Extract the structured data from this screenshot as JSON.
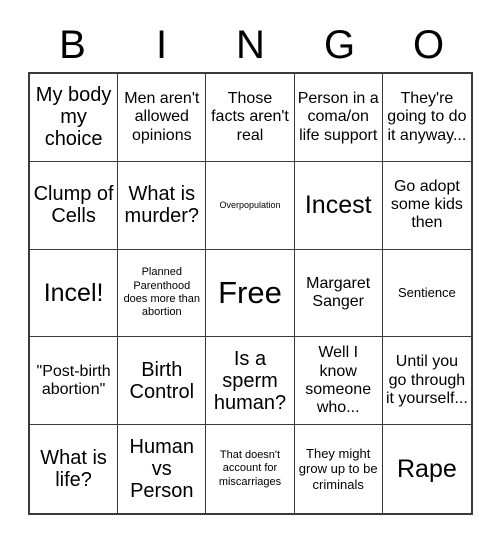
{
  "header": {
    "letters": [
      "B",
      "I",
      "N",
      "G",
      "O"
    ]
  },
  "grid": {
    "rows": 5,
    "columns": 5,
    "free_space_index": 12,
    "cells": [
      {
        "text": "My body my choice",
        "size": "lg"
      },
      {
        "text": "Men aren't allowed opinions",
        "size": "md"
      },
      {
        "text": "Those facts aren't real",
        "size": "md"
      },
      {
        "text": "Person in a coma/on life support",
        "size": "md"
      },
      {
        "text": "They're going to do it anyway...",
        "size": "md"
      },
      {
        "text": "Clump of Cells",
        "size": "lg"
      },
      {
        "text": "What is murder?",
        "size": "lg"
      },
      {
        "text": "Overpopulation",
        "size": "xxs"
      },
      {
        "text": "Incest",
        "size": "xl"
      },
      {
        "text": "Go adopt some kids then",
        "size": "md"
      },
      {
        "text": "Incel!",
        "size": "xl"
      },
      {
        "text": "Planned Parenthood does more than abortion",
        "size": "xs"
      },
      {
        "text": "Free",
        "size": "xxl"
      },
      {
        "text": "Margaret Sanger",
        "size": "md"
      },
      {
        "text": "Sentience",
        "size": "sm"
      },
      {
        "text": "\"Post-birth abortion\"",
        "size": "md"
      },
      {
        "text": "Birth Control",
        "size": "lg"
      },
      {
        "text": "Is a sperm human?",
        "size": "lg"
      },
      {
        "text": "Well I know someone who...",
        "size": "md"
      },
      {
        "text": "Until you go through it yourself...",
        "size": "md"
      },
      {
        "text": "What is life?",
        "size": "lg"
      },
      {
        "text": "Human vs Person",
        "size": "lg"
      },
      {
        "text": "That doesn't account for miscarriages",
        "size": "xs"
      },
      {
        "text": "They might grow up to be criminals",
        "size": "sm"
      },
      {
        "text": "Rape",
        "size": "xl"
      }
    ]
  },
  "colors": {
    "background": "#ffffff",
    "text": "#000000",
    "grid_line": "#3a3a3a"
  }
}
